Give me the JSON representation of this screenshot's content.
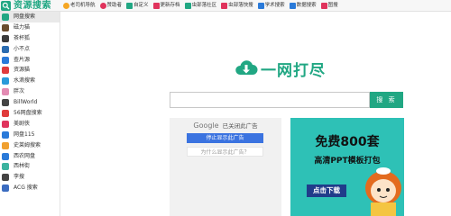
{
  "brand": {
    "name": "资源搜索",
    "color": "#21a783"
  },
  "topnav": [
    {
      "label": "老司机导航",
      "icon": "star-icon",
      "color": "#f5a623"
    },
    {
      "label": "赞助者",
      "icon": "heart-icon",
      "color": "#e0335c"
    },
    {
      "label": "自定义",
      "icon": "gear-icon",
      "color": "#21a783"
    },
    {
      "label": "更新存档",
      "icon": "archive-icon",
      "color": "#e0335c"
    },
    {
      "label": "虫部落社区",
      "icon": "bug-icon",
      "color": "#21a783"
    },
    {
      "label": "虫部落快搜",
      "icon": "bug-icon",
      "color": "#e0335c"
    },
    {
      "label": "学术搜索",
      "icon": "graduation-cap-icon",
      "color": "#2a7ad9"
    },
    {
      "label": "数据搜索",
      "icon": "chart-icon",
      "color": "#2a7ad9"
    },
    {
      "label": "图搜",
      "icon": "image-icon",
      "color": "#e0335c"
    }
  ],
  "sidebar": [
    {
      "label": "网盘搜索",
      "color": "#21a783"
    },
    {
      "label": "磁力猫",
      "color": "#6a4c2d"
    },
    {
      "label": "茶杯狐",
      "color": "#3b3b3b"
    },
    {
      "label": "小不点",
      "color": "#2b6cb0"
    },
    {
      "label": "查片源",
      "color": "#2a7ad9"
    },
    {
      "label": "资源猫",
      "color": "#e03b3b"
    },
    {
      "label": "水滴搜索",
      "color": "#2a9ad9"
    },
    {
      "label": "胖次",
      "color": "#e38bb3"
    },
    {
      "label": "BillWorld",
      "color": "#444444"
    },
    {
      "label": "56网盘搜索",
      "color": "#e03b3b"
    },
    {
      "label": "美剧侠",
      "color": "#e0335c"
    },
    {
      "label": "网盘115",
      "color": "#2a7ad9"
    },
    {
      "label": "史莱姆搜索",
      "color": "#f0a030"
    },
    {
      "label": "西农网盘",
      "color": "#2a7ad9"
    },
    {
      "label": "西林街",
      "color": "#3bb3a0"
    },
    {
      "label": "李搜",
      "color": "#444444"
    },
    {
      "label": "ACG 搜索",
      "color": "#3b6cc0"
    }
  ],
  "logo_text": "一网打尽",
  "search": {
    "value": "",
    "placeholder": "",
    "button_label": "搜 索"
  },
  "google_ad": {
    "brand": "Google",
    "status": "已关闭此广告",
    "stop_label": "停止显示此广告",
    "why_label": "为什么显示此广告？"
  },
  "promo_ad": {
    "title": "免费800套",
    "subtitle": "高清PPT模板打包",
    "cta": "点击下载",
    "bg_color": "#2ec1b6"
  }
}
